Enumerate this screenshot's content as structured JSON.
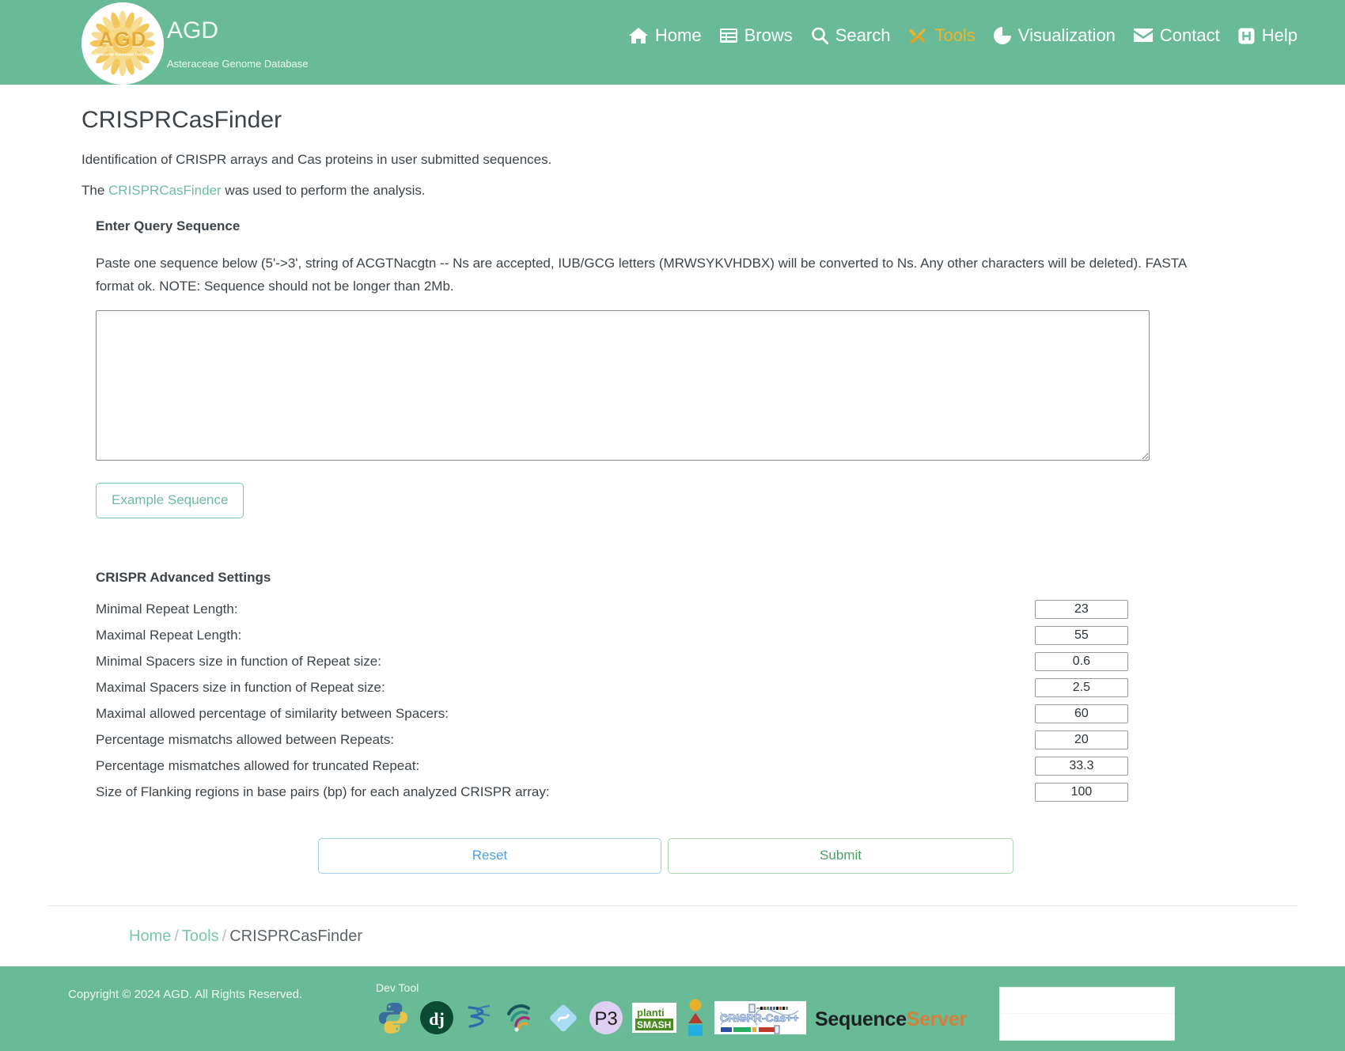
{
  "header": {
    "logo": {
      "acronym": "AGD",
      "tagline": "Asteraceae Genome Database",
      "icon": "sunflower-icon"
    },
    "brand_title": "AGD",
    "brand_subtitle": "Asteraceae Genome Database",
    "nav": [
      {
        "label": "Home",
        "icon": "home-icon",
        "active": false
      },
      {
        "label": "Brows",
        "icon": "list-icon",
        "active": false
      },
      {
        "label": "Search",
        "icon": "search-icon",
        "active": false
      },
      {
        "label": "Tools",
        "icon": "tools-icon",
        "active": true
      },
      {
        "label": "Visualization",
        "icon": "pie-chart-icon",
        "active": false
      },
      {
        "label": "Contact",
        "icon": "envelope-icon",
        "active": false
      },
      {
        "label": "Help",
        "icon": "help-square-icon",
        "active": false
      }
    ],
    "accent_color": "#68bb96",
    "active_color": "#f0b429"
  },
  "main": {
    "title": "CRISPRCasFinder",
    "description": "Identification of CRISPR arrays and Cas proteins in user submitted sequences.",
    "attribution_prefix": "The ",
    "attribution_link": "CRISPRCasFinder",
    "attribution_suffix": " was used to perform the analysis.",
    "query_section_label": "Enter Query Sequence",
    "query_help": "Paste one sequence below (5'->3', string of ACGTNacgtn -- Ns are accepted, IUB/GCG letters (MRWSYKVHDBX) will be converted to Ns. Any other characters will be deleted). FASTA format ok. NOTE: Sequence should not be longer than 2Mb.",
    "sequence_value": "",
    "sequence_placeholder": "",
    "example_button": "Example Sequence",
    "advanced_title": "CRISPR Advanced Settings",
    "settings": [
      {
        "label": "Minimal Repeat Length:",
        "value": "23"
      },
      {
        "label": "Maximal Repeat Length:",
        "value": "55"
      },
      {
        "label": "Minimal Spacers size in function of Repeat size:",
        "value": "0.6"
      },
      {
        "label": "Maximal Spacers size in function of Repeat size:",
        "value": "2.5"
      },
      {
        "label": "Maximal allowed percentage of similarity between Spacers:",
        "value": "60"
      },
      {
        "label": "Percentage mismatchs allowed between Repeats:",
        "value": "20"
      },
      {
        "label": "Percentage mismatches allowed for truncated Repeat:",
        "value": "33.3"
      },
      {
        "label": "Size of Flanking regions in base pairs (bp) for each analyzed CRISPR array:",
        "value": "100"
      }
    ],
    "reset_button": "Reset",
    "submit_button": "Submit"
  },
  "breadcrumb": {
    "items": [
      {
        "label": "Home",
        "link": true
      },
      {
        "label": "Tools",
        "link": true
      },
      {
        "label": "CRISPRCasFinder",
        "link": false
      }
    ],
    "separator": "/"
  },
  "footer": {
    "copyright": "Copyright © 2024 AGD. All Rights Reserved.",
    "devtool_label": "Dev Tool",
    "devtool_icons": [
      "python-icon",
      "django-icon",
      "biopython-spiral-icon",
      "circos-arc-icon",
      "jbrowse-diamond-icon",
      "p3-icon",
      "plantismash-icon",
      "shapes-icon",
      "crispr-cas-plusplus-icon",
      "sequenceserver-icon"
    ],
    "sequenceserver": {
      "first": "Sequence",
      "second": "Server"
    },
    "plantismash": {
      "first": "planti",
      "second": "SMASH"
    },
    "p3_label": "P3",
    "crispr_logo_text": "CRISPR-Cas++"
  }
}
